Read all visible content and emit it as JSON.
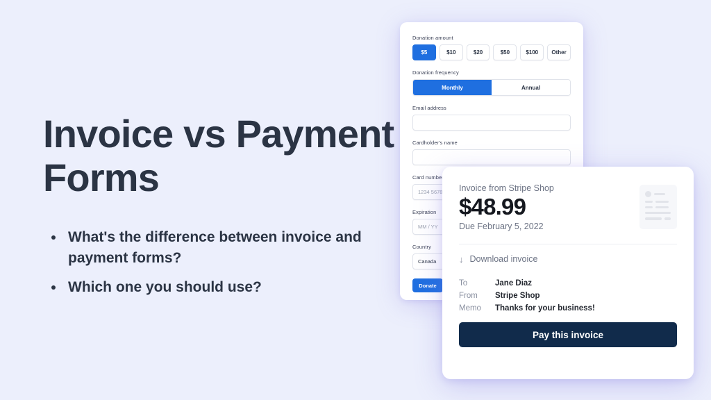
{
  "slide": {
    "background_color": "#eceffc",
    "headline": "Invoice vs Payment Forms",
    "bullets": [
      "What's the difference between invoice and payment forms?",
      "Which one you should use?"
    ]
  },
  "donation_form": {
    "amount_label": "Donation amount",
    "amounts": [
      {
        "label": "$5",
        "selected": true
      },
      {
        "label": "$10",
        "selected": false
      },
      {
        "label": "$20",
        "selected": false
      },
      {
        "label": "$50",
        "selected": false
      },
      {
        "label": "$100",
        "selected": false
      },
      {
        "label": "Other",
        "selected": false
      }
    ],
    "frequency_label": "Donation frequency",
    "frequencies": [
      {
        "label": "Monthly",
        "selected": true
      },
      {
        "label": "Annual",
        "selected": false
      }
    ],
    "email_label": "Email address",
    "email_value": "",
    "cardholder_label": "Cardholder's name",
    "cardholder_value": "",
    "card_number_label": "Card number",
    "card_number_placeholder": "1234 5678",
    "expiration_label": "Expiration",
    "expiration_placeholder": "MM / YY",
    "country_label": "Country",
    "country_value": "Canada",
    "donate_label": "Donate",
    "accent_color": "#1f6fe0"
  },
  "invoice_card": {
    "from_line": "Invoice from Stripe Shop",
    "amount": "$48.99",
    "due_line": "Due February 5, 2022",
    "download_label": "Download invoice",
    "download_icon": "arrow-down-icon",
    "meta": [
      {
        "key": "To",
        "value": "Jane Diaz"
      },
      {
        "key": "From",
        "value": "Stripe Shop"
      },
      {
        "key": "Memo",
        "value": "Thanks for your business!"
      }
    ],
    "pay_label": "Pay this invoice",
    "pay_color": "#112b4b"
  }
}
